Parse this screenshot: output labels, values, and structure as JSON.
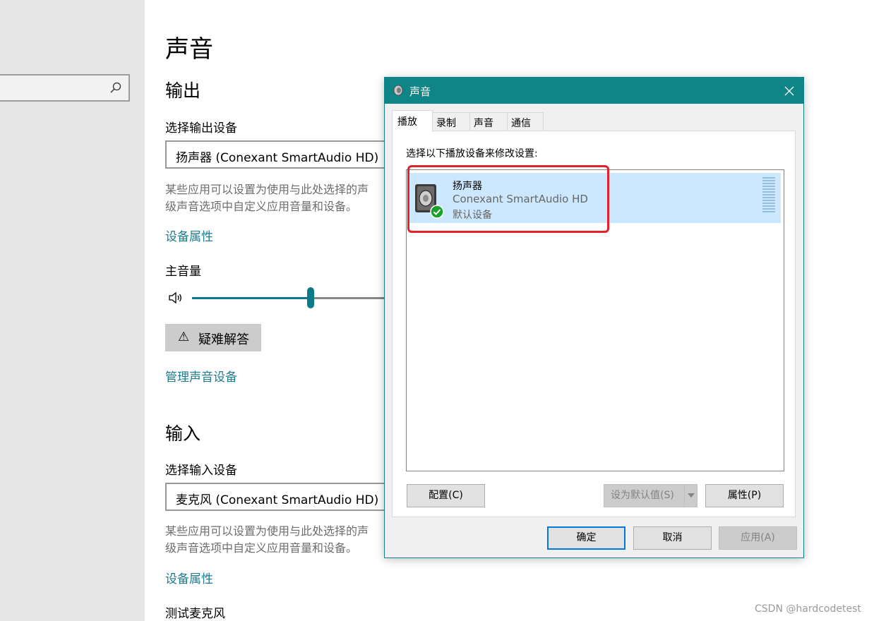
{
  "settings": {
    "page_title": "声音",
    "output": {
      "heading": "输出",
      "choose_label": "选择输出设备",
      "device_value": "扬声器 (Conexant SmartAudio HD)",
      "desc_line1": "某些应用可以设置为使用与此处选择的声",
      "desc_line2": "级声音选项中自定义应用音量和设备。",
      "device_properties_link": "设备属性",
      "master_volume_label": "主音量",
      "volume_level": 0.56,
      "troubleshoot_label": "疑难解答",
      "manage_devices_link": "管理声音设备"
    },
    "input": {
      "heading": "输入",
      "choose_label": "选择输入设备",
      "device_value": "麦克风 (Conexant SmartAudio HD)",
      "desc_line1": "某些应用可以设置为使用与此处选择的声",
      "desc_line2": "级声音选项中自定义应用音量和设备。",
      "device_properties_link": "设备属性",
      "test_mic_label": "测试麦克风"
    }
  },
  "dialog": {
    "title": "声音",
    "tabs": [
      {
        "label": "播放"
      },
      {
        "label": "录制"
      },
      {
        "label": "声音"
      },
      {
        "label": "通信"
      }
    ],
    "active_tab": "播放",
    "instruction": "选择以下播放设备来修改设置:",
    "device": {
      "name": "扬声器",
      "driver": "Conexant SmartAudio HD",
      "status": "默认设备"
    },
    "configure_button": "配置(C)",
    "set_default_button": "设为默认值(S)",
    "properties_button": "属性(P)",
    "ok_button": "确定",
    "cancel_button": "取消",
    "apply_button": "应用(A)"
  },
  "watermark": "CSDN @hardcodetest",
  "colors": {
    "accent_teal": "#0f8588",
    "link": "#1f7a8c",
    "selection": "#cce8ff",
    "annotation_red": "#e3232c"
  }
}
